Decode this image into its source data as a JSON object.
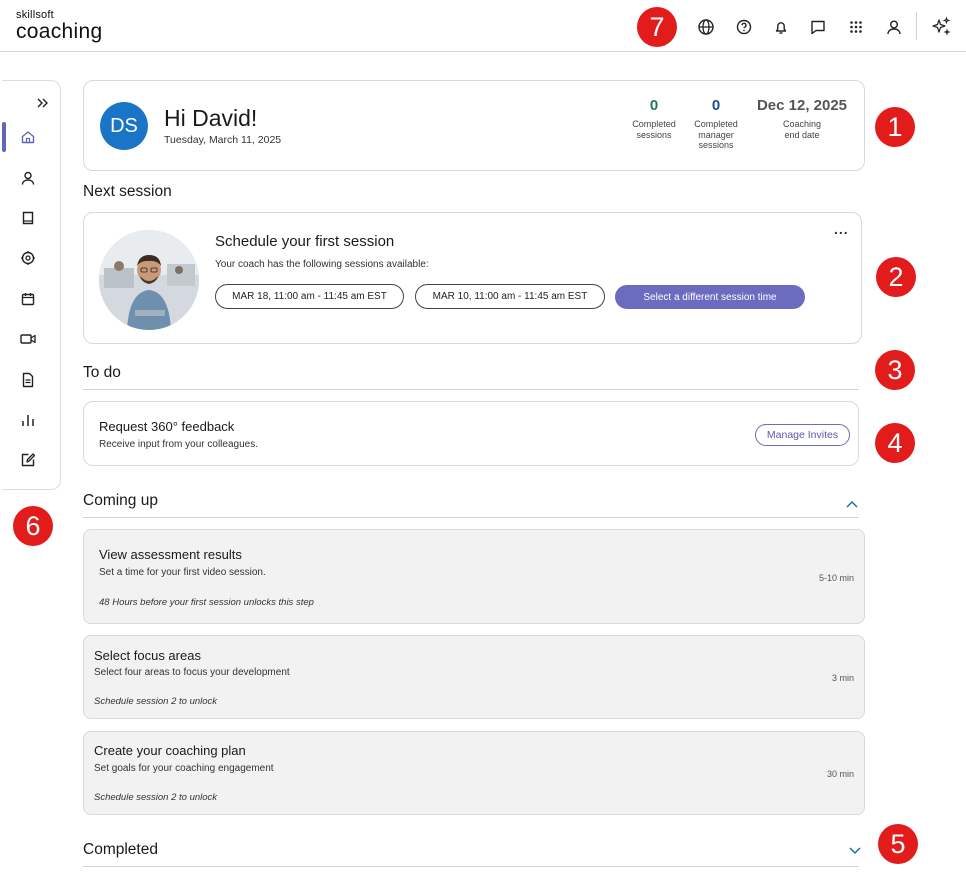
{
  "header": {
    "logo_top": "skillsoft",
    "logo_main": "coaching",
    "icons": [
      "globe-icon",
      "help-icon",
      "bell-icon",
      "chat-icon",
      "apps-grid-icon",
      "user-icon",
      "sparkle-icon"
    ]
  },
  "callouts": [
    "1",
    "2",
    "3",
    "4",
    "5",
    "6",
    "7"
  ],
  "sidebar": {
    "items": [
      "home-icon",
      "profile-icon",
      "book-icon",
      "focus-icon",
      "calendar-icon",
      "video-icon",
      "document-icon",
      "chart-icon",
      "edit-icon"
    ]
  },
  "greeting": {
    "initials": "DS",
    "title": "Hi David!",
    "date": "Tuesday, March 11, 2025",
    "stats": [
      {
        "value": "0",
        "label_lines": [
          "Completed",
          "sessions"
        ],
        "color": "#1f7a5a"
      },
      {
        "value": "0",
        "label_lines": [
          "Completed",
          "manager",
          "sessions"
        ],
        "color": "#1d4f91"
      },
      {
        "value": "Dec 12, 2025",
        "label_lines": [
          "Coaching",
          "end date"
        ],
        "color": "#555555"
      }
    ]
  },
  "next_session": {
    "heading": "Next session",
    "title": "Schedule your first session",
    "subtitle": "Your coach has the following sessions available:",
    "slot1": "MAR 18, 11:00 am - 11:45 am EST",
    "slot2": "MAR 10, 11:00 am - 11:45 am EST",
    "different_time": "Select a different session time",
    "more": "..."
  },
  "todo": {
    "heading": "To do",
    "title": "Request 360° feedback",
    "subtitle": "Receive input from your colleagues.",
    "button": "Manage Invites"
  },
  "coming_up": {
    "heading": "Coming up",
    "items": [
      {
        "title": "View assessment results",
        "subtitle": "Set a time for your first video session.",
        "note": "48 Hours before your first session unlocks this step",
        "time": "5-10 min"
      },
      {
        "title": "Select focus areas",
        "subtitle": "Select four areas to focus your development",
        "note": "Schedule session 2 to unlock",
        "time": "3 min"
      },
      {
        "title": "Create your coaching plan",
        "subtitle": "Set goals for your coaching engagement",
        "note": "Schedule session 2 to unlock",
        "time": "30 min"
      }
    ]
  },
  "completed": {
    "heading": "Completed"
  },
  "colors": {
    "accent": "#6b6bc0",
    "callout": "#e21b1b",
    "avatar": "#1b75c6",
    "chevron": "#1d6fa8"
  }
}
